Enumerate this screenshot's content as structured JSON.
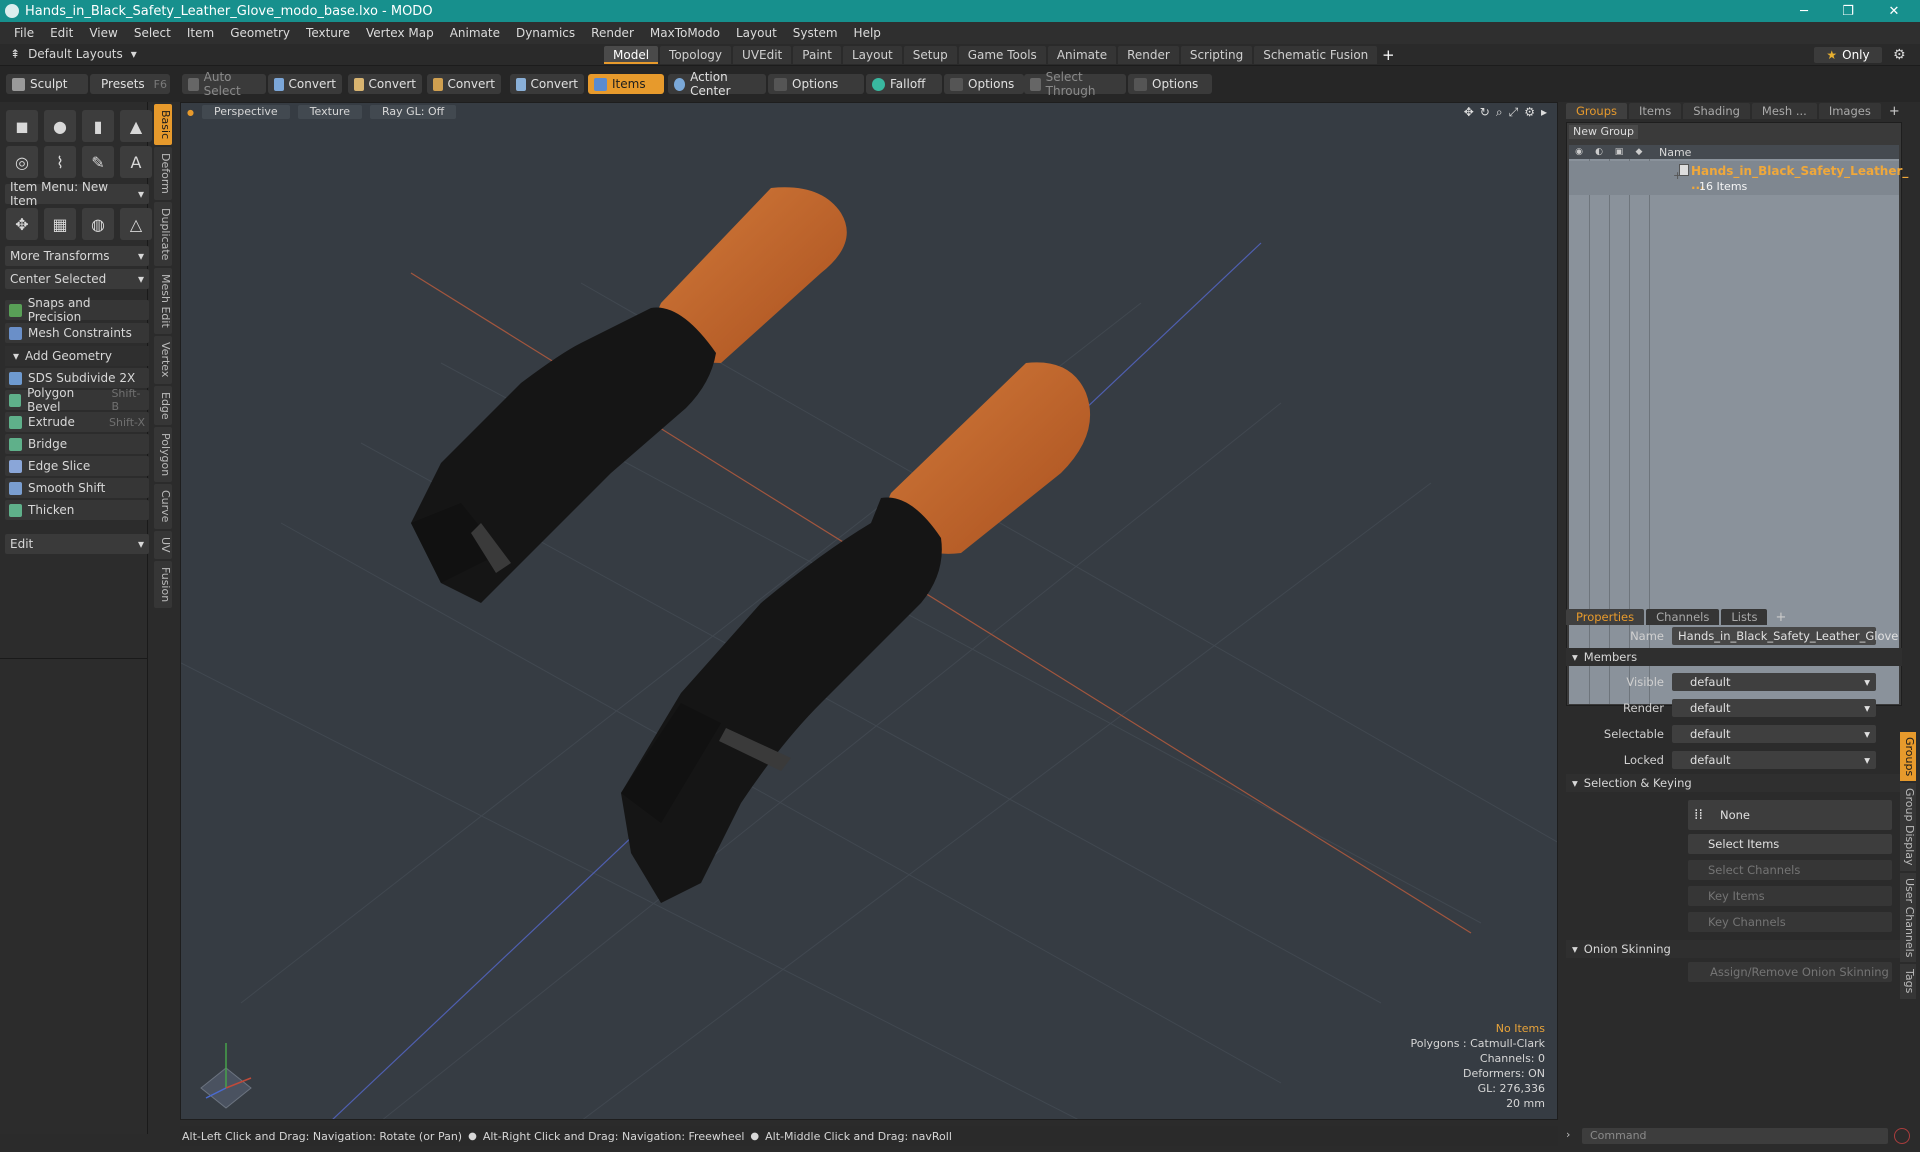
{
  "window": {
    "title": "Hands_in_Black_Safety_Leather_Glove_modo_base.lxo - MODO",
    "controls": [
      "─",
      "❐",
      "✕"
    ]
  },
  "menu": [
    "File",
    "Edit",
    "View",
    "Select",
    "Item",
    "Geometry",
    "Texture",
    "Vertex Map",
    "Animate",
    "Dynamics",
    "Render",
    "MaxToModo",
    "Layout",
    "System",
    "Help"
  ],
  "layout_row": {
    "default_layouts": "Default Layouts",
    "tabs": [
      "Model",
      "Topology",
      "UVEdit",
      "Paint",
      "Layout",
      "Setup",
      "Game Tools",
      "Animate",
      "Render",
      "Scripting",
      "Schematic Fusion"
    ],
    "active_tab": "Model",
    "only_label": "Only"
  },
  "toolbar": {
    "sculpt": "Sculpt",
    "presets": "Presets",
    "presets_key": "F6",
    "auto_select": "Auto Select",
    "convert1": "Convert",
    "convert2": "Convert",
    "convert3": "Convert",
    "convert4": "Convert",
    "items": "Items",
    "action_center": "Action Center",
    "options1": "Options",
    "falloff": "Falloff",
    "options2": "Options",
    "select_through": "Select Through",
    "options3": "Options"
  },
  "left": {
    "item_menu": "Item Menu: New Item",
    "more_transforms": "More Transforms",
    "center_selected": "Center Selected",
    "snaps": "Snaps and Precision",
    "mesh_constraints": "Mesh Constraints",
    "add_geometry": "Add Geometry",
    "tools": [
      {
        "label": "SDS Subdivide 2X",
        "shortcut": ""
      },
      {
        "label": "Polygon Bevel",
        "shortcut": "Shift-B"
      },
      {
        "label": "Extrude",
        "shortcut": "Shift-X"
      },
      {
        "label": "Bridge",
        "shortcut": ""
      },
      {
        "label": "Edge Slice",
        "shortcut": ""
      },
      {
        "label": "Smooth Shift",
        "shortcut": ""
      },
      {
        "label": "Thicken",
        "shortcut": ""
      }
    ],
    "edit": "Edit",
    "vtabs": [
      "Basic",
      "Deform",
      "Duplicate",
      "Mesh Edit",
      "Vertex",
      "Edge",
      "Polygon",
      "Curve",
      "UV",
      "Fusion"
    ]
  },
  "viewport": {
    "perspective": "Perspective",
    "texture": "Texture",
    "raygl": "Ray GL: Off",
    "info": {
      "no_items": "No Items",
      "polygons": "Polygons : Catmull-Clark",
      "channels": "Channels: 0",
      "deformers": "Deformers: ON",
      "gl": "GL: 276,336",
      "scale": "20 mm"
    }
  },
  "status": {
    "hint1": "Alt-Left Click and Drag: Navigation: Rotate (or Pan)",
    "hint2": "Alt-Right Click and Drag: Navigation: Freewheel",
    "hint3": "Alt-Middle Click and Drag: navRoll"
  },
  "groups_panel": {
    "tabs": [
      "Groups",
      "Items",
      "Shading",
      "Mesh ...",
      "Images"
    ],
    "new_group": "New Group",
    "name_header": "Name",
    "group_name": "Hands_in_Black_Safety_Leather_ ...",
    "group_count": "16 Items"
  },
  "properties": {
    "tabs": [
      "Properties",
      "Channels",
      "Lists"
    ],
    "name_label": "Name",
    "name_value": "Hands_in_Black_Safety_Leather_Glove",
    "members": "Members",
    "visible_label": "Visible",
    "visible_value": "default",
    "render_label": "Render",
    "render_value": "default",
    "selectable_label": "Selectable",
    "selectable_value": "default",
    "locked_label": "Locked",
    "locked_value": "default",
    "selection_keying": "Selection & Keying",
    "none": "None",
    "select_items": "Select Items",
    "select_channels": "Select Channels",
    "key_items": "Key Items",
    "key_channels": "Key Channels",
    "onion_skinning": "Onion Skinning",
    "assign_onion": "Assign/Remove Onion Skinning",
    "vtabs": [
      "Groups",
      "Group Display",
      "User Channels",
      "Tags"
    ]
  },
  "command_placeholder": "Command",
  "colors": {
    "accent": "#e79a2c",
    "titlebar": "#17908d",
    "viewport_bg": "#363c43",
    "leather": "#c0642a",
    "glove": "#141414"
  }
}
